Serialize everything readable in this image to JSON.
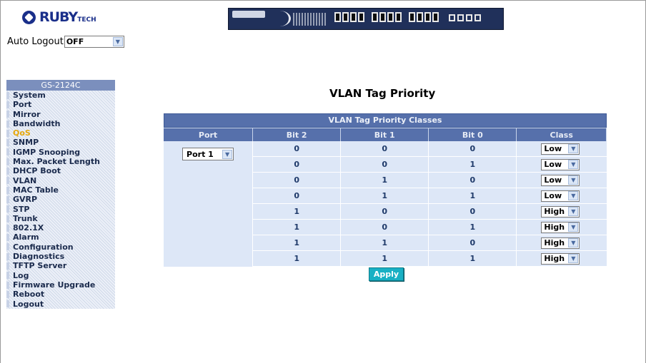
{
  "logo": {
    "text": "RUBY",
    "suffix": "TECH"
  },
  "auto_logout": {
    "label": "Auto Logout",
    "value": "OFF"
  },
  "sidebar": {
    "title": "GS-2124C",
    "items": [
      "System",
      "Port",
      "Mirror",
      "Bandwidth",
      "QoS",
      "SNMP",
      "IGMP Snooping",
      "Max. Packet Length",
      "DHCP Boot",
      "VLAN",
      "MAC Table",
      "GVRP",
      "STP",
      "Trunk",
      "802.1X",
      "Alarm",
      "Configuration",
      "Diagnostics",
      "TFTP Server",
      "Log",
      "Firmware Upgrade",
      "Reboot",
      "Logout"
    ],
    "active": "QoS"
  },
  "page_title": "VLAN Tag Priority",
  "table": {
    "caption": "VLAN Tag Priority Classes",
    "headers": [
      "Port",
      "Bit 2",
      "Bit 1",
      "Bit 0",
      "Class"
    ],
    "port_value": "Port 1",
    "rows": [
      {
        "bit2": "0",
        "bit1": "0",
        "bit0": "0",
        "class": "Low"
      },
      {
        "bit2": "0",
        "bit1": "0",
        "bit0": "1",
        "class": "Low"
      },
      {
        "bit2": "0",
        "bit1": "1",
        "bit0": "0",
        "class": "Low"
      },
      {
        "bit2": "0",
        "bit1": "1",
        "bit0": "1",
        "class": "Low"
      },
      {
        "bit2": "1",
        "bit1": "0",
        "bit0": "0",
        "class": "High"
      },
      {
        "bit2": "1",
        "bit1": "0",
        "bit0": "1",
        "class": "High"
      },
      {
        "bit2": "1",
        "bit1": "1",
        "bit0": "0",
        "class": "High"
      },
      {
        "bit2": "1",
        "bit1": "1",
        "bit0": "1",
        "class": "High"
      }
    ]
  },
  "apply_label": "Apply",
  "colors": {
    "header_blue": "#5670ab",
    "cell_bg": "#dde7f7",
    "active_nav": "#e6a70a",
    "apply_bg": "#19b0c4"
  }
}
